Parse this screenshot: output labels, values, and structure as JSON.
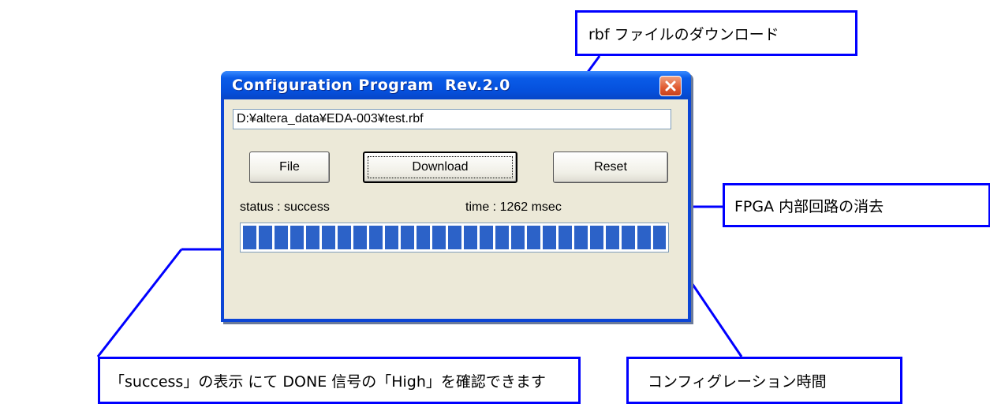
{
  "window": {
    "title": "Configuration Program  Rev.2.0",
    "file_path": "D:¥altera_data¥EDA-003¥test.rbf",
    "buttons": {
      "file": "File",
      "download": "Download",
      "reset": "Reset"
    },
    "status": "status : success",
    "time": "time : 1262 msec",
    "progress_fraction": 1.0
  },
  "callouts": {
    "download": "rbf ファイルのダウンロード",
    "reset": "FPGA 内部回路の消去",
    "success": "「success」の表示  にて DONE 信号の「High」を確認できます",
    "time": "コンフィグレーション時間"
  },
  "colors": {
    "annotation": "#0000ff",
    "titlebar": "#0550dc",
    "progress": "#2c62c8"
  }
}
